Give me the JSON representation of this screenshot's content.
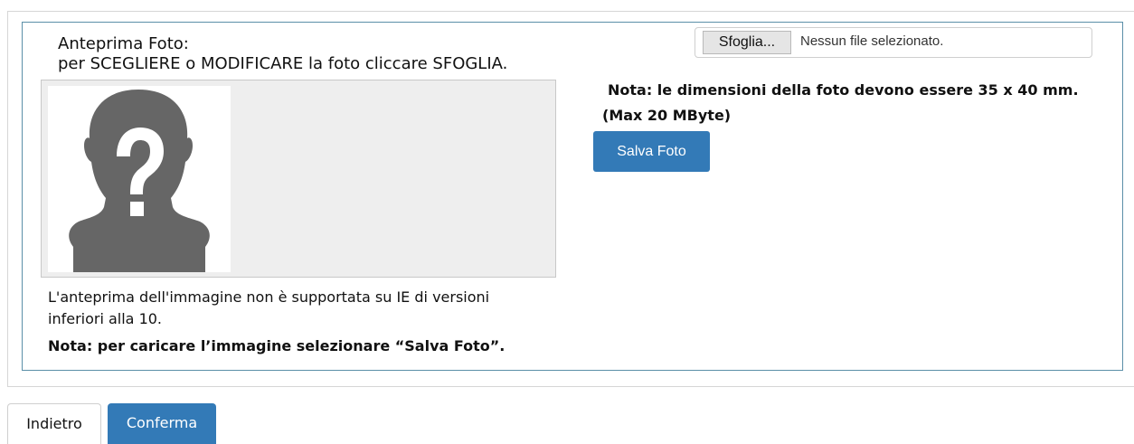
{
  "preview": {
    "title_line1": "Anteprima Foto:",
    "title_line2": "per SCEGLIERE o MODIFICARE la foto cliccare SFOGLIA.",
    "placeholder_icon": "person-silhouette-question-icon",
    "ie_note_line1": "L'anteprima dell'immagine non è supportata su IE di versioni",
    "ie_note_line2": "inferiori alla 10.",
    "upload_note": "Nota: per caricare l’immagine selezionare “Salva Foto”."
  },
  "upload": {
    "browse_label": "Sfoglia...",
    "file_status": "Nessun file selezionato.",
    "dimensions_note": "Nota: le dimensioni della foto devono essere 35 x 40 mm.",
    "size_note": "(Max 20 MByte)",
    "save_label": "Salva Foto"
  },
  "footer": {
    "back_label": "Indietro",
    "confirm_label": "Conferma"
  },
  "colors": {
    "primary": "#337ab7",
    "panel_border": "#5b8fa8",
    "silhouette": "#666666",
    "preview_bg": "#eeeeee"
  }
}
